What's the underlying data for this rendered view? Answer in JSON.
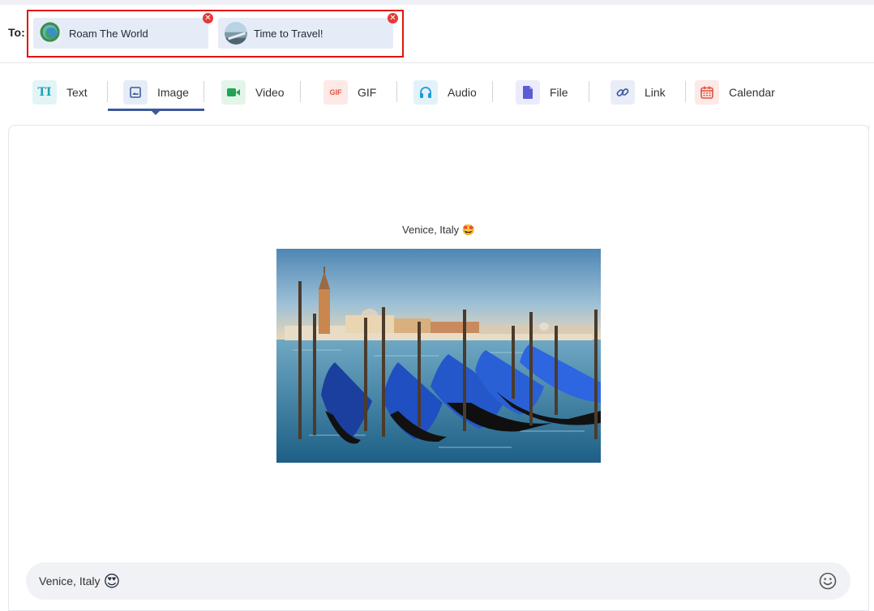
{
  "recipients": {
    "label": "To:",
    "chips": [
      {
        "name": "Roam The World",
        "avatar": "globe-avatar"
      },
      {
        "name": "Time to Travel!",
        "avatar": "road-avatar"
      }
    ],
    "remove_glyph": "✕"
  },
  "tabs": [
    {
      "label": "Text",
      "icon": "text-format-icon",
      "glyph": "TI",
      "color": "#1aa6b7",
      "bg": "#e3f4f7"
    },
    {
      "label": "Image",
      "icon": "image-icon",
      "glyph": "▣",
      "color": "#3d5a99",
      "bg": "#e6ecf7",
      "active": true
    },
    {
      "label": "Video",
      "icon": "video-icon",
      "glyph": "▶",
      "color": "#21a453",
      "bg": "#e3f5e9"
    },
    {
      "label": "GIF",
      "icon": "gif-icon",
      "glyph": "GIF",
      "color": "#e0533f",
      "bg": "#fde9e6"
    },
    {
      "label": "Audio",
      "icon": "headphones-icon",
      "glyph": "🎧",
      "color": "#1e9ad6",
      "bg": "#e2f2fb"
    },
    {
      "label": "File",
      "icon": "file-icon",
      "glyph": "▮",
      "color": "#5b5bd6",
      "bg": "#ebebfb"
    },
    {
      "label": "Link",
      "icon": "link-icon",
      "glyph": "🔗",
      "color": "#3d5a99",
      "bg": "#e8edf7"
    },
    {
      "label": "Calendar",
      "icon": "calendar-icon",
      "glyph": "▦",
      "color": "#e0533f",
      "bg": "#fde9e6"
    }
  ],
  "post": {
    "caption": "Venice, Italy 🤩",
    "image_alt": "gondolas-photo"
  },
  "composer": {
    "text": "Venice, Italy",
    "emoji": "😍",
    "emoji_button": "☺"
  }
}
